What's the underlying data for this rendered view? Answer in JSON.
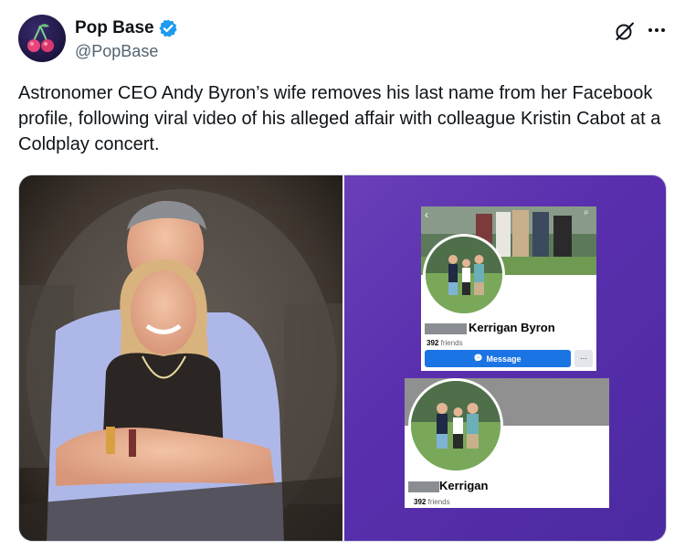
{
  "author": {
    "display_name": "Pop Base",
    "handle": "@PopBase",
    "verified_icon": "verified-badge-icon",
    "avatar_icon": "cherries-logo-icon",
    "verified_color": "#1d9bf0"
  },
  "actions": {
    "grok_icon": "grok-slash-icon",
    "more_icon": "more-horizontal-icon",
    "more_label": "···"
  },
  "tweet": {
    "text": "Astronomer CEO Andy Byron’s wife removes his last name from her Facebook profile, following viral video of his alleged affair with colleague Kristin Cabot at a Coldplay concert."
  },
  "media": {
    "left_photo_description": "kiss-cam-photo",
    "right_background_color": "#5a2fae",
    "profile_1": {
      "back_glyph": "‹",
      "search_glyph": "⌕",
      "surname": "Kerrigan Byron",
      "friends_count": "392",
      "friends_label": "friends",
      "message_label": "Message",
      "message_icon": "messenger-icon",
      "more_label": "···"
    },
    "profile_2": {
      "surname": "Kerrigan",
      "friends_count": "392",
      "friends_label": "friends"
    }
  }
}
